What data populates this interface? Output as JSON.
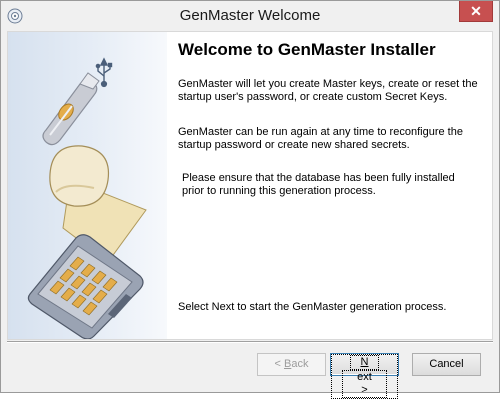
{
  "window": {
    "title": "GenMaster Welcome",
    "close_symbol": "✕"
  },
  "content": {
    "heading": "Welcome to GenMaster Installer",
    "paragraphs": [
      "GenMaster will let you create Master keys, create or reset the startup user's password, or create custom Secret Keys.",
      "GenMaster can be run again at any time to reconfigure the startup password or create new shared secrets.",
      "Please ensure that the database has been fully installed prior to running this generation process.",
      "Select Next to start the GenMaster generation process."
    ]
  },
  "buttons": {
    "back_prefix": "< ",
    "back_hotkey": "B",
    "back_rest": "ack",
    "next_hotkey": "N",
    "next_rest": "ext >",
    "cancel": "Cancel"
  },
  "icons": {
    "title": "installer-disc-icon",
    "sidebar": [
      "usb-key-icon",
      "usb-symbol-icon",
      "key-icon",
      "keypad-device-icon"
    ]
  }
}
